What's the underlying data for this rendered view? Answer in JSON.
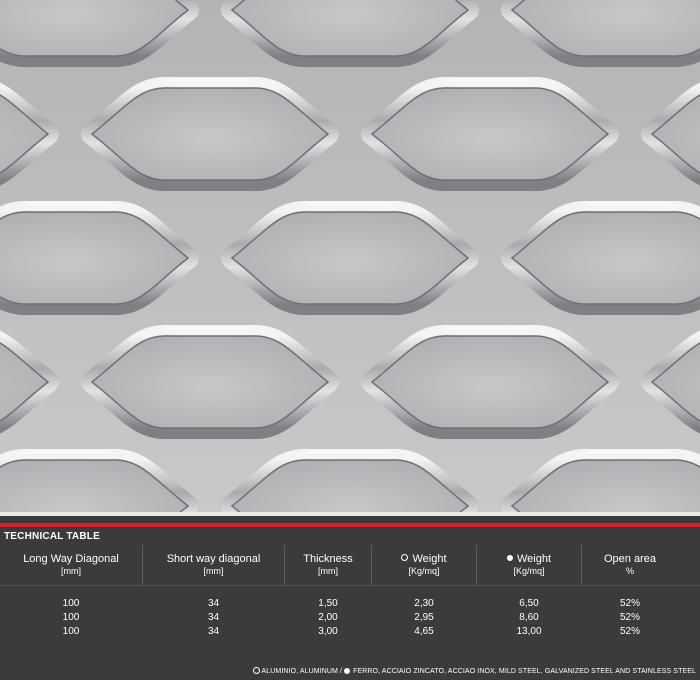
{
  "table": {
    "title": "TECHNICAL TABLE",
    "headers": [
      {
        "label": "Long Way Diagonal",
        "unit": "[mm]",
        "marker": "none"
      },
      {
        "label": "Short way diagonal",
        "unit": "[mm]",
        "marker": "none"
      },
      {
        "label": "Thickness",
        "unit": "[mm]",
        "marker": "none"
      },
      {
        "label": "Weight",
        "unit": "[Kg/mq]",
        "marker": "ring-icon"
      },
      {
        "label": "Weight",
        "unit": "[Kg/mq]",
        "marker": "dot-icon"
      },
      {
        "label": "Open area",
        "unit": "%",
        "marker": "none"
      }
    ],
    "rows": [
      [
        "100",
        "34",
        "1,50",
        "2,30",
        "6,50",
        "52%"
      ],
      [
        "100",
        "34",
        "2,00",
        "2,95",
        "8,60",
        "52%"
      ],
      [
        "100",
        "34",
        "3,00",
        "4,65",
        "13,00",
        "52%"
      ]
    ]
  },
  "footer": {
    "aluminium_label": "ALUMINIO, ALUMINUM /",
    "steel_label": "FERRO, ACCIAIO ZINCATO, ACCIAO INOX, MILD STEEL, GALVANIZED STEEL AND STAINLESS STEEL"
  },
  "colors": {
    "accent": "#d4212b",
    "panel": "#3b3b3b",
    "mesh": "#c4c5c8"
  }
}
